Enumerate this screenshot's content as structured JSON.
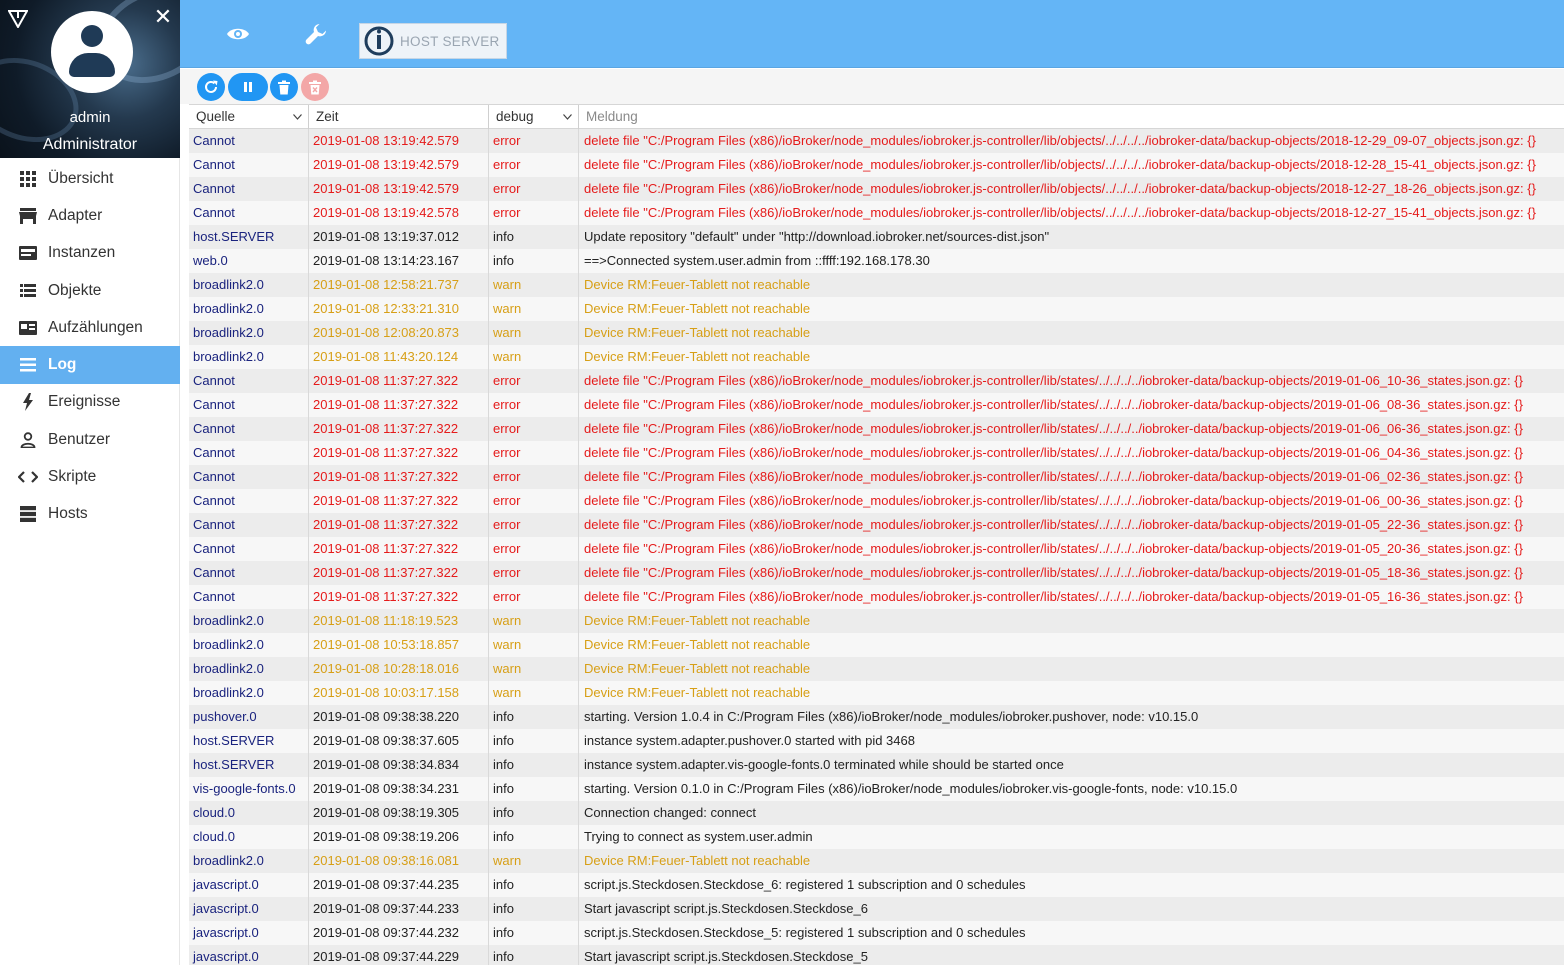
{
  "user": {
    "name": "admin",
    "role": "Administrator"
  },
  "nav": [
    {
      "label": "Übersicht",
      "icon": "grid-icon"
    },
    {
      "label": "Adapter",
      "icon": "store-icon"
    },
    {
      "label": "Instanzen",
      "icon": "instances-icon"
    },
    {
      "label": "Objekte",
      "icon": "list-icon"
    },
    {
      "label": "Aufzählungen",
      "icon": "enum-icon"
    },
    {
      "label": "Log",
      "icon": "menu-icon",
      "active": true
    },
    {
      "label": "Ereignisse",
      "icon": "flash-icon"
    },
    {
      "label": "Benutzer",
      "icon": "person-icon"
    },
    {
      "label": "Skripte",
      "icon": "code-icon"
    },
    {
      "label": "Hosts",
      "icon": "server-icon"
    }
  ],
  "topbar": {
    "host_label": "HOST SERVER"
  },
  "colors": {
    "accent": "#64b5f6",
    "active_nav": "#63b0f0",
    "error": "#e51b1b",
    "warn": "#d79f16",
    "source": "#1a237e"
  },
  "table": {
    "headers": {
      "source": "Quelle",
      "time": "Zeit",
      "severity": "debug",
      "message": "Meldung"
    },
    "rows": [
      {
        "src": "Cannot",
        "time": "2019-01-08 13:19:42.579",
        "sev": "error",
        "msg": "delete file \"C:/Program Files (x86)/ioBroker/node_modules/iobroker.js-controller/lib/objects/../../../../iobroker-data/backup-objects/2018-12-29_09-07_objects.json.gz: {}"
      },
      {
        "src": "Cannot",
        "time": "2019-01-08 13:19:42.579",
        "sev": "error",
        "msg": "delete file \"C:/Program Files (x86)/ioBroker/node_modules/iobroker.js-controller/lib/objects/../../../../iobroker-data/backup-objects/2018-12-28_15-41_objects.json.gz: {}"
      },
      {
        "src": "Cannot",
        "time": "2019-01-08 13:19:42.579",
        "sev": "error",
        "msg": "delete file \"C:/Program Files (x86)/ioBroker/node_modules/iobroker.js-controller/lib/objects/../../../../iobroker-data/backup-objects/2018-12-27_18-26_objects.json.gz: {}"
      },
      {
        "src": "Cannot",
        "time": "2019-01-08 13:19:42.578",
        "sev": "error",
        "msg": "delete file \"C:/Program Files (x86)/ioBroker/node_modules/iobroker.js-controller/lib/objects/../../../../iobroker-data/backup-objects/2018-12-27_15-41_objects.json.gz: {}"
      },
      {
        "src": "host.SERVER",
        "time": "2019-01-08 13:19:37.012",
        "sev": "info",
        "msg": "Update repository \"default\" under \"http://download.iobroker.net/sources-dist.json\""
      },
      {
        "src": "web.0",
        "time": "2019-01-08 13:14:23.167",
        "sev": "info",
        "msg": "==>Connected system.user.admin from ::ffff:192.168.178.30"
      },
      {
        "src": "broadlink2.0",
        "time": "2019-01-08 12:58:21.737",
        "sev": "warn",
        "msg": "Device RM:Feuer-Tablett not reachable"
      },
      {
        "src": "broadlink2.0",
        "time": "2019-01-08 12:33:21.310",
        "sev": "warn",
        "msg": "Device RM:Feuer-Tablett not reachable"
      },
      {
        "src": "broadlink2.0",
        "time": "2019-01-08 12:08:20.873",
        "sev": "warn",
        "msg": "Device RM:Feuer-Tablett not reachable"
      },
      {
        "src": "broadlink2.0",
        "time": "2019-01-08 11:43:20.124",
        "sev": "warn",
        "msg": "Device RM:Feuer-Tablett not reachable"
      },
      {
        "src": "Cannot",
        "time": "2019-01-08 11:37:27.322",
        "sev": "error",
        "msg": "delete file \"C:/Program Files (x86)/ioBroker/node_modules/iobroker.js-controller/lib/states/../../../../iobroker-data/backup-objects/2019-01-06_10-36_states.json.gz: {}"
      },
      {
        "src": "Cannot",
        "time": "2019-01-08 11:37:27.322",
        "sev": "error",
        "msg": "delete file \"C:/Program Files (x86)/ioBroker/node_modules/iobroker.js-controller/lib/states/../../../../iobroker-data/backup-objects/2019-01-06_08-36_states.json.gz: {}"
      },
      {
        "src": "Cannot",
        "time": "2019-01-08 11:37:27.322",
        "sev": "error",
        "msg": "delete file \"C:/Program Files (x86)/ioBroker/node_modules/iobroker.js-controller/lib/states/../../../../iobroker-data/backup-objects/2019-01-06_06-36_states.json.gz: {}"
      },
      {
        "src": "Cannot",
        "time": "2019-01-08 11:37:27.322",
        "sev": "error",
        "msg": "delete file \"C:/Program Files (x86)/ioBroker/node_modules/iobroker.js-controller/lib/states/../../../../iobroker-data/backup-objects/2019-01-06_04-36_states.json.gz: {}"
      },
      {
        "src": "Cannot",
        "time": "2019-01-08 11:37:27.322",
        "sev": "error",
        "msg": "delete file \"C:/Program Files (x86)/ioBroker/node_modules/iobroker.js-controller/lib/states/../../../../iobroker-data/backup-objects/2019-01-06_02-36_states.json.gz: {}"
      },
      {
        "src": "Cannot",
        "time": "2019-01-08 11:37:27.322",
        "sev": "error",
        "msg": "delete file \"C:/Program Files (x86)/ioBroker/node_modules/iobroker.js-controller/lib/states/../../../../iobroker-data/backup-objects/2019-01-06_00-36_states.json.gz: {}"
      },
      {
        "src": "Cannot",
        "time": "2019-01-08 11:37:27.322",
        "sev": "error",
        "msg": "delete file \"C:/Program Files (x86)/ioBroker/node_modules/iobroker.js-controller/lib/states/../../../../iobroker-data/backup-objects/2019-01-05_22-36_states.json.gz: {}"
      },
      {
        "src": "Cannot",
        "time": "2019-01-08 11:37:27.322",
        "sev": "error",
        "msg": "delete file \"C:/Program Files (x86)/ioBroker/node_modules/iobroker.js-controller/lib/states/../../../../iobroker-data/backup-objects/2019-01-05_20-36_states.json.gz: {}"
      },
      {
        "src": "Cannot",
        "time": "2019-01-08 11:37:27.322",
        "sev": "error",
        "msg": "delete file \"C:/Program Files (x86)/ioBroker/node_modules/iobroker.js-controller/lib/states/../../../../iobroker-data/backup-objects/2019-01-05_18-36_states.json.gz: {}"
      },
      {
        "src": "Cannot",
        "time": "2019-01-08 11:37:27.322",
        "sev": "error",
        "msg": "delete file \"C:/Program Files (x86)/ioBroker/node_modules/iobroker.js-controller/lib/states/../../../../iobroker-data/backup-objects/2019-01-05_16-36_states.json.gz: {}"
      },
      {
        "src": "broadlink2.0",
        "time": "2019-01-08 11:18:19.523",
        "sev": "warn",
        "msg": "Device RM:Feuer-Tablett not reachable"
      },
      {
        "src": "broadlink2.0",
        "time": "2019-01-08 10:53:18.857",
        "sev": "warn",
        "msg": "Device RM:Feuer-Tablett not reachable"
      },
      {
        "src": "broadlink2.0",
        "time": "2019-01-08 10:28:18.016",
        "sev": "warn",
        "msg": "Device RM:Feuer-Tablett not reachable"
      },
      {
        "src": "broadlink2.0",
        "time": "2019-01-08 10:03:17.158",
        "sev": "warn",
        "msg": "Device RM:Feuer-Tablett not reachable"
      },
      {
        "src": "pushover.0",
        "time": "2019-01-08 09:38:38.220",
        "sev": "info",
        "msg": "starting. Version 1.0.4 in C:/Program Files (x86)/ioBroker/node_modules/iobroker.pushover, node: v10.15.0"
      },
      {
        "src": "host.SERVER",
        "time": "2019-01-08 09:38:37.605",
        "sev": "info",
        "msg": "instance system.adapter.pushover.0 started with pid 3468"
      },
      {
        "src": "host.SERVER",
        "time": "2019-01-08 09:38:34.834",
        "sev": "info",
        "msg": "instance system.adapter.vis-google-fonts.0 terminated while should be started once"
      },
      {
        "src": "vis-google-fonts.0",
        "time": "2019-01-08 09:38:34.231",
        "sev": "info",
        "msg": "starting. Version 0.1.0 in C:/Program Files (x86)/ioBroker/node_modules/iobroker.vis-google-fonts, node: v10.15.0"
      },
      {
        "src": "cloud.0",
        "time": "2019-01-08 09:38:19.305",
        "sev": "info",
        "msg": "Connection changed: connect"
      },
      {
        "src": "cloud.0",
        "time": "2019-01-08 09:38:19.206",
        "sev": "info",
        "msg": "Trying to connect as system.user.admin"
      },
      {
        "src": "broadlink2.0",
        "time": "2019-01-08 09:38:16.081",
        "sev": "warn",
        "msg": "Device RM:Feuer-Tablett not reachable"
      },
      {
        "src": "javascript.0",
        "time": "2019-01-08 09:37:44.235",
        "sev": "info",
        "msg": "script.js.Steckdosen.Steckdose_6: registered 1 subscription and 0 schedules"
      },
      {
        "src": "javascript.0",
        "time": "2019-01-08 09:37:44.233",
        "sev": "info",
        "msg": "Start javascript script.js.Steckdosen.Steckdose_6"
      },
      {
        "src": "javascript.0",
        "time": "2019-01-08 09:37:44.232",
        "sev": "info",
        "msg": "script.js.Steckdosen.Steckdose_5: registered 1 subscription and 0 schedules"
      },
      {
        "src": "javascript.0",
        "time": "2019-01-08 09:37:44.229",
        "sev": "info",
        "msg": "Start javascript script.js.Steckdosen.Steckdose_5"
      }
    ]
  }
}
